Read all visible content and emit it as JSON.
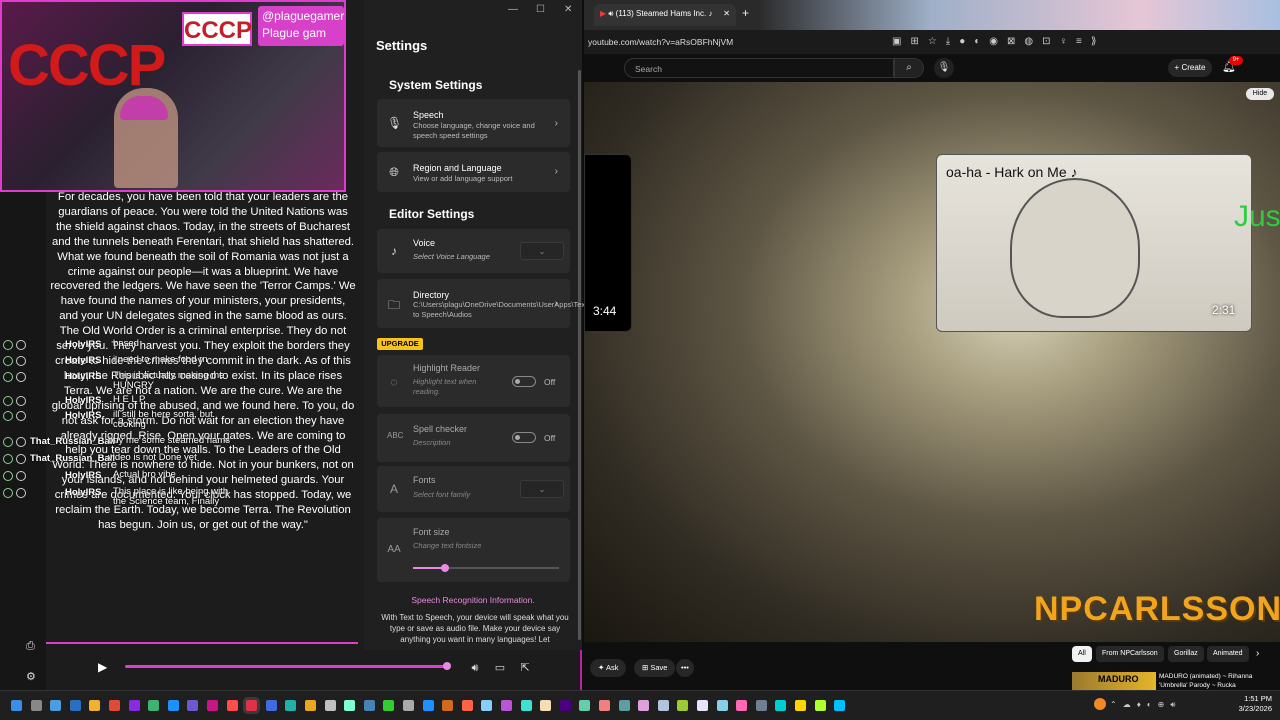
{
  "webcam": {
    "logo_text": "CCCP",
    "logo_small": "CCCP",
    "handle": "@plaguegamer",
    "handle2": "Plague gam"
  },
  "speech_text": "For decades, you have been told that your leaders are the guardians of peace. You were told the United Nations was the shield against chaos. Today, in the streets of Bucharest and the tunnels beneath Ferentari, that shield has shattered. What we found beneath the soil of Romania was not just a crime against our people—it was a blueprint. We have recovered the ledgers. We have seen the 'Terror Camps.' We have found the names of your ministers, your presidents, and your UN delegates signed in the same blood as ours. The Old World Order is a criminal enterprise. They do not serve you. They harvest you. They exploit the borders they create to hide the crimes they commit in the dark. As of this hour, the Republic has ceased to exist. In its place rises Terra. We are not a nation. We are the cure. We are the global uprising of the abused, and we found here. To you, do not ask for a storm. Do not wait for an election they have already rigged. Rise. Open your gates. We are coming to help you tear down the walls. To the Leaders of the Old World: There is nowhere to hide. Not in your bunkers, not on your islands, and not behind your helmeted guards. Your crimes are documented. Your clock has stopped. Today, we reclaim the Earth. Today, we become Terra. The Revolution has begun. Join us, or get out of the way.\"",
  "chat": [
    {
      "user": "HolyIRS",
      "msg": "based"
    },
    {
      "user": "HolyIRS",
      "msg": "i need to make food rn"
    },
    {
      "user": "HolyIRS",
      "msg": "This is actually making me HUNGRY"
    },
    {
      "user": "HolyIRS",
      "msg": "H E L P"
    },
    {
      "user": "HolyIRS",
      "msg": "ill still be here sorta, but cooking"
    },
    {
      "user": "That_Russian_Ball",
      "msg": "buy me some steamed hams"
    },
    {
      "user": "That_Russian_Ball",
      "msg": "video is not Done yet"
    },
    {
      "user": "HolyIRS",
      "msg": "Actual bro vibe"
    },
    {
      "user": "HolyIRS",
      "msg": "This place is like being with the Science team, Finally"
    }
  ],
  "settings": {
    "title": "Settings",
    "system_settings": "System Settings",
    "speech_title": "Speech",
    "speech_sub": "Choose language, change voice and speech speed settings",
    "region_title": "Region and Language",
    "region_sub": "View or add language support",
    "editor_settings": "Editor Settings",
    "voice_title": "Voice",
    "voice_sub": "Select Voice Language",
    "directory_title": "Directory",
    "directory_sub": "C:\\Users\\plagu\\OneDrive\\Documents\\UserApps\\Text to Speech\\Audios",
    "upgrade": "UPGRADE",
    "highlight_title": "Highlight Reader",
    "highlight_sub": "Highlight text when reading.",
    "highlight_state": "Off",
    "spell_title": "Spell checker",
    "spell_sub": "Description",
    "spell_state": "Off",
    "fonts_title": "Fonts",
    "fonts_sub": "Select font family",
    "fontsize_title": "Font size",
    "fontsize_sub": "Change text fontsize",
    "fontsize_level": 0.22,
    "sr_link": "Speech Recognition Information.",
    "sr_body": "With Text to Speech, your device will speak what you type or save as audio file. Make your device say anything you want in many languages! Let"
  },
  "player": {
    "progress": 0.99
  },
  "browser": {
    "tab_title": "(113) Steamed Hams Inc. ♪",
    "url": "youtube.com/watch?v=aRsOBFhNjVM",
    "search_placeholder": "Search",
    "create": "Create",
    "notif": "9+",
    "hide": "Hide",
    "left_duration": "3:44",
    "right_title": "oa-ha - Hark on Me ♪",
    "right_duration": "2:31",
    "right_overlay": "Jus",
    "logo": "NPCARLSSON",
    "ask": "Ask",
    "save": "Save",
    "chips": [
      "All",
      "From NPCarlsson",
      "Gorillaz",
      "Animated"
    ],
    "rec_thumb": "MADURO",
    "rec_title": "MADURO (animated) ~ Rihanna 'Umbrella' Parody ~ Rucka"
  },
  "taskbar": {
    "time": "1:51 PM",
    "date": "3/23/2026"
  },
  "colors": {
    "accent": "#e13bd0",
    "upgrade": "#f6c21c",
    "yt_red": "#ff0000"
  }
}
